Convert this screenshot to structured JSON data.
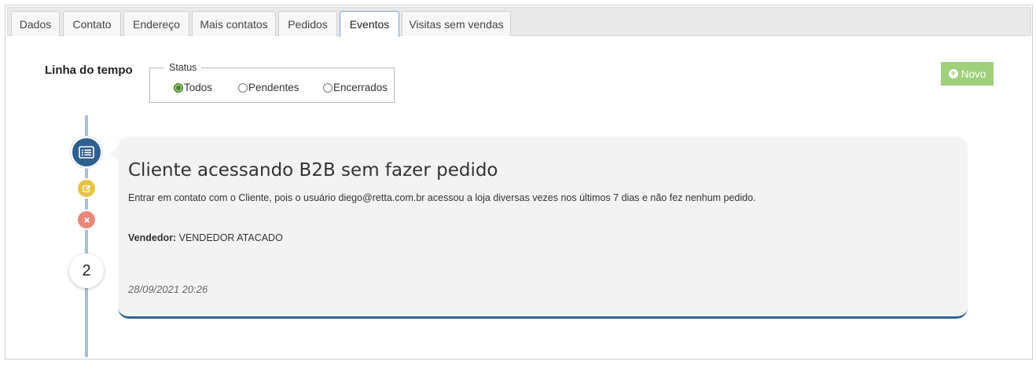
{
  "tabs": [
    {
      "label": "Dados",
      "active": false
    },
    {
      "label": "Contato",
      "active": false
    },
    {
      "label": "Endereço",
      "active": false
    },
    {
      "label": "Mais contatos",
      "active": false
    },
    {
      "label": "Pedidos",
      "active": false
    },
    {
      "label": "Eventos",
      "active": true
    },
    {
      "label": "Visitas sem vendas",
      "active": false
    }
  ],
  "header": {
    "title": "Linha do tempo",
    "status_legend": "Status",
    "status_options": [
      {
        "label": "Todos",
        "checked": true
      },
      {
        "label": "Pendentes",
        "checked": false
      },
      {
        "label": "Encerrados",
        "checked": false
      }
    ],
    "new_button": "Novo"
  },
  "timeline": {
    "count": "2",
    "event": {
      "title": "Cliente acessando B2B sem fazer pedido",
      "description": "Entrar em contato com o Cliente, pois o usuário diego@retta.com.br acessou a loja diversas vezes nos últimos 7 dias e não fez nenhum pedido.",
      "seller_label": "Vendedor:",
      "seller_value": "VENDEDOR ATACADO",
      "date": "28/09/2021 20:26"
    }
  },
  "colors": {
    "accent_blue": "#2f5f8e",
    "new_button_green": "#9fd07a",
    "edit_yellow": "#e8c34a",
    "close_red": "#e8887a"
  },
  "icons": {
    "event_type": "list-card-icon",
    "edit": "edit-icon",
    "close": "close-icon",
    "new": "plus-circle-icon"
  }
}
